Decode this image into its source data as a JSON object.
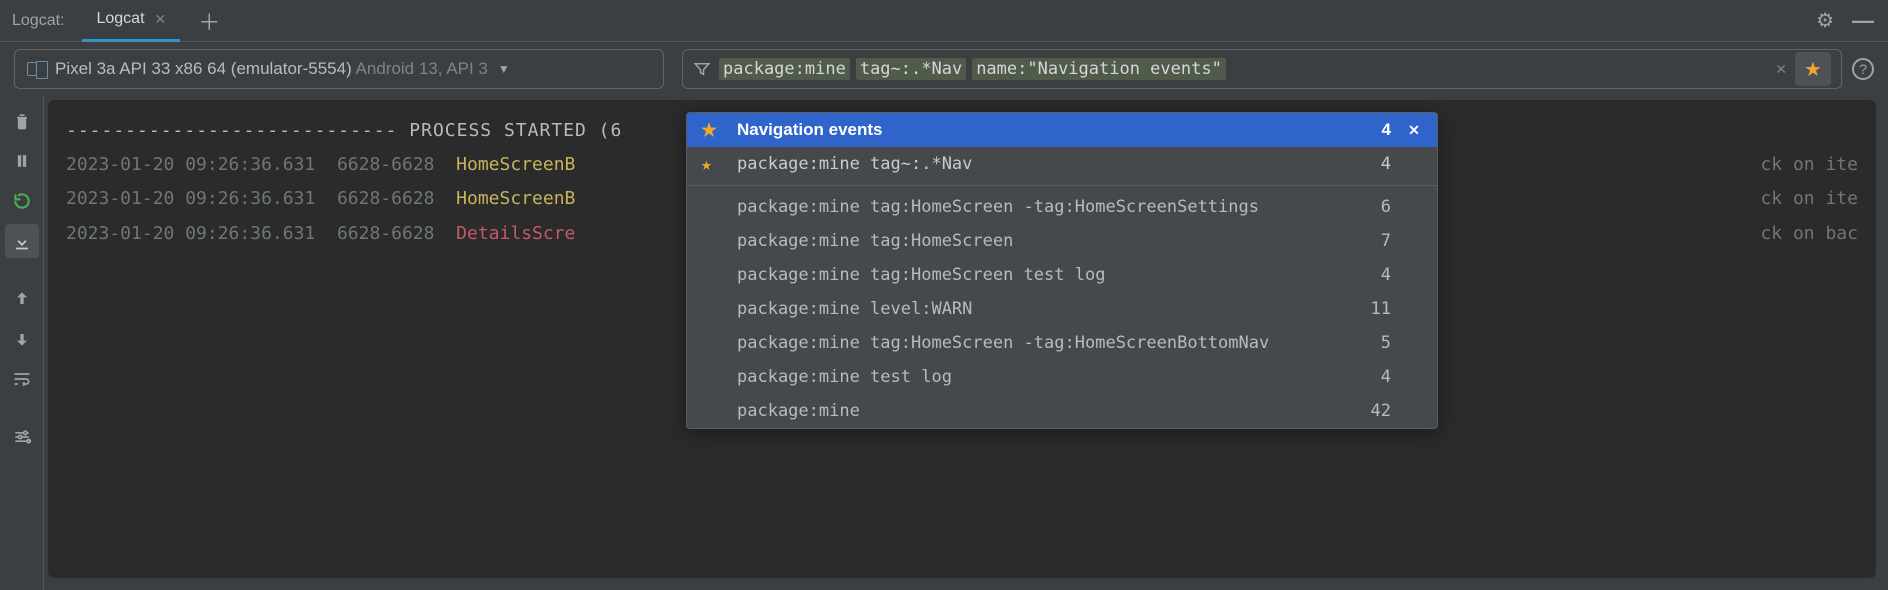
{
  "tabs": {
    "title": "Logcat:",
    "active": "Logcat"
  },
  "device": {
    "name": "Pixel 3a API 33 x86 64 (emulator-5554)",
    "meta": "Android 13, API 3"
  },
  "filter": {
    "token1": "package:mine",
    "token2": "tag~:.*Nav",
    "token3": "name:\"Navigation events\""
  },
  "logs": {
    "line0": "---------------------------- PROCESS STARTED (6",
    "ts": "2023-01-20 09:26:36.631",
    "pid": "6628-6628",
    "tag_home": "HomeScreenB",
    "tag_details": "DetailsScre",
    "tail_item": "ck on ite",
    "tail_back": "ck on bac"
  },
  "popup": {
    "fav1_label": "Navigation events",
    "fav1_count": "4",
    "fav2_label": "package:mine tag~:.*Nav",
    "fav2_count": "4",
    "h1_label": "package:mine tag:HomeScreen -tag:HomeScreenSettings",
    "h1_count": "6",
    "h2_label": "package:mine tag:HomeScreen",
    "h2_count": "7",
    "h3_label": "package:mine tag:HomeScreen test log",
    "h3_count": "4",
    "h4_label": "package:mine level:WARN",
    "h4_count": "11",
    "h5_label": "package:mine tag:HomeScreen -tag:HomeScreenBottomNav",
    "h5_count": "5",
    "h6_label": "package:mine test log",
    "h6_count": "4",
    "h7_label": "package:mine",
    "h7_count": "42"
  }
}
